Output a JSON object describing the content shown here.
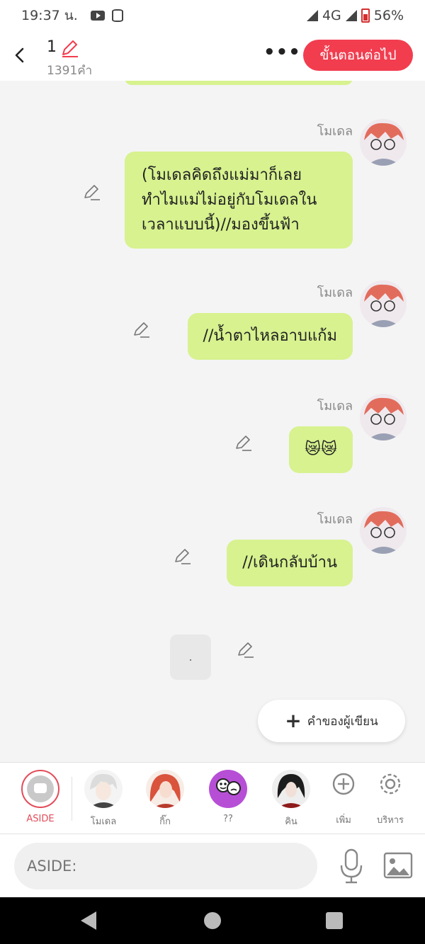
{
  "status_bar": {
    "time": "19:37 น.",
    "network": "4G",
    "battery": "56%"
  },
  "header": {
    "chapter_number": "1",
    "word_count": "1391คำ",
    "next_step_label": "ขั้นตอนต่อไป"
  },
  "messages": [
    {
      "speaker": "โมเดล",
      "lines": [
        "(โมเดลคิดถึงแม่มาก็เลย",
        "ทำไมแม่ไม่อยู่กับโมเดลใน",
        "เวลาแบบนี้)//มองขึ้นฟ้า"
      ]
    },
    {
      "speaker": "โมเดล",
      "text": "//น้ำตาไหลอาบแก้ม"
    },
    {
      "speaker": "โมเดล",
      "text": "😿😿"
    },
    {
      "speaker": "โมเดล",
      "text": "//เดินกลับบ้าน"
    }
  ],
  "system_message": ".",
  "author_button_label": "คำของผู้เขียน",
  "characters": [
    {
      "label": "ASIDE"
    },
    {
      "label": "โมเดล"
    },
    {
      "label": "กิ๊ก"
    },
    {
      "label": "??"
    },
    {
      "label": "คิน"
    },
    {
      "label": "เพิ่ม"
    },
    {
      "label": "บริหาร"
    }
  ],
  "input": {
    "placeholder": "ASIDE:"
  },
  "colors": {
    "accent": "#f23d4f",
    "bubble": "#d7f28f",
    "aside_label": "#e24d5a"
  },
  "icons": [
    "back-icon",
    "pencil-icon",
    "more-icon",
    "edit-icon",
    "plus-icon",
    "add-circle-icon",
    "settings-icon",
    "mic-icon",
    "image-icon"
  ]
}
